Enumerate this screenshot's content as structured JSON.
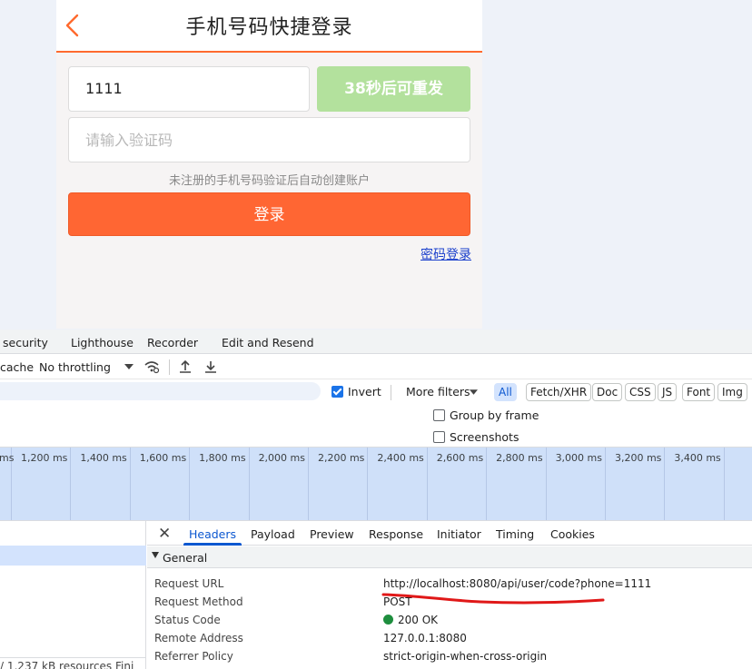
{
  "mobile": {
    "title": "手机号码快捷登录",
    "phone_value": "1111",
    "resend_label": "38秒后可重发",
    "code_placeholder": "请输入验证码",
    "hint": "未注册的手机号码验证后自动创建账户",
    "login_label": "登录",
    "password_login_link": "密码登录",
    "colors": {
      "accent": "#ff6633",
      "resend_disabled": "#b3e19d"
    }
  },
  "devtools": {
    "tabs": [
      "security",
      "Lighthouse",
      "Recorder",
      "Edit and Resend"
    ],
    "toolbar": {
      "cache_label": "cache",
      "throttling": "No throttling"
    },
    "filter": {
      "invert_label": "Invert",
      "more_filters": "More filters",
      "types": [
        "All",
        "Fetch/XHR",
        "Doc",
        "CSS",
        "JS",
        "Font",
        "Img"
      ]
    },
    "options": {
      "group_by_frame": "Group by frame",
      "screenshots": "Screenshots"
    },
    "timeline_ticks": [
      "ms",
      "1,200 ms",
      "1,400 ms",
      "1,600 ms",
      "1,800 ms",
      "2,000 ms",
      "2,200 ms",
      "2,400 ms",
      "2,600 ms",
      "2,800 ms",
      "3,000 ms",
      "3,200 ms",
      "3,400 ms",
      "3,6"
    ],
    "status_bar": "/ 1,237 kB resources   Fini",
    "detail_tabs": [
      "Headers",
      "Payload",
      "Preview",
      "Response",
      "Initiator",
      "Timing",
      "Cookies"
    ],
    "general": {
      "title": "General",
      "rows": [
        {
          "key": "Request URL",
          "value": "http://localhost:8080/api/user/code?phone=1111"
        },
        {
          "key": "Request Method",
          "value": "POST"
        },
        {
          "key": "Status Code",
          "value": "200 OK"
        },
        {
          "key": "Remote Address",
          "value": "127.0.0.1:8080"
        },
        {
          "key": "Referrer Policy",
          "value": "strict-origin-when-cross-origin"
        }
      ]
    }
  }
}
